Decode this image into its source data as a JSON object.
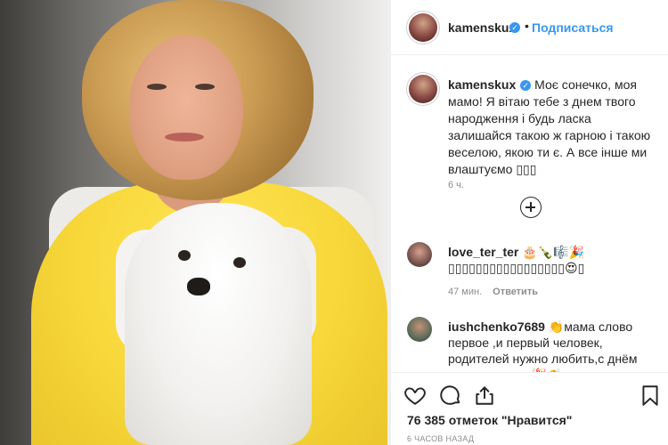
{
  "post": {
    "photo_description_icon": "photo-placeholder",
    "author": {
      "username": "kamenskux",
      "verified_icon": "verified-badge-icon",
      "separator": "•",
      "follow_label": "Подписаться"
    },
    "caption": {
      "username": "kamenskux",
      "text": "Моє сонечко, моя мамо! Я вітаю тебе з днем твого народження і будь ласка залишайся такою ж гарною і такою веселою, якою ти є. А все інше ми влаштуємо ▯▯▯",
      "time": "6 ч."
    },
    "comments": [
      {
        "username": "love_ter_ter",
        "text": "🎂🍾🎼🎉▯▯▯▯▯▯▯▯▯▯▯▯▯▯▯▯▯😍▯",
        "time": "47 мин.",
        "reply_label": "Ответить"
      },
      {
        "username": "iushchenko7689",
        "text": "👏мама слово первое ,и первый человек, родителей нужно любить,с днём рождения вас 🎉👏",
        "time": "",
        "reply_label": ""
      }
    ],
    "likes": "76 385 отметок \"Нравится\"",
    "posted": "6 ЧАСОВ НАЗАД"
  },
  "colors": {
    "link": "#3897f0",
    "text": "#262626",
    "muted": "#8e8e8e",
    "border": "#efefef"
  }
}
